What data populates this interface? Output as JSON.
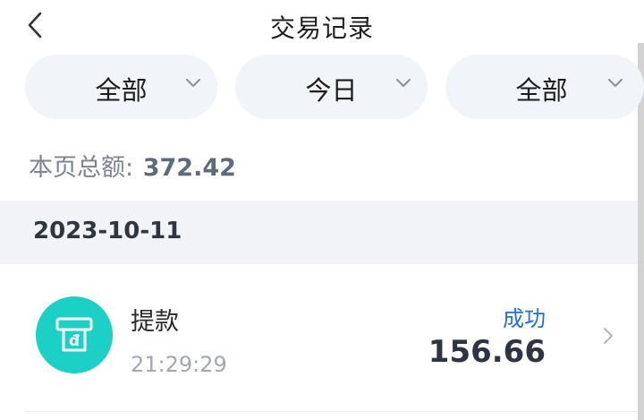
{
  "header": {
    "title": "交易记录"
  },
  "filters": [
    {
      "label": "全部"
    },
    {
      "label": "今日"
    },
    {
      "label": "全部"
    }
  ],
  "summary": {
    "label": "本页总额:",
    "amount": "372.42"
  },
  "groups": [
    {
      "date": "2023-10-11",
      "transactions": [
        {
          "icon": "cash-withdrawal-icon",
          "name": "提款",
          "time": "21:29:29",
          "status": "成功",
          "amount": "156.66",
          "icon_color": "#1bd0c4",
          "status_color": "#1f6fe0"
        }
      ]
    }
  ]
}
